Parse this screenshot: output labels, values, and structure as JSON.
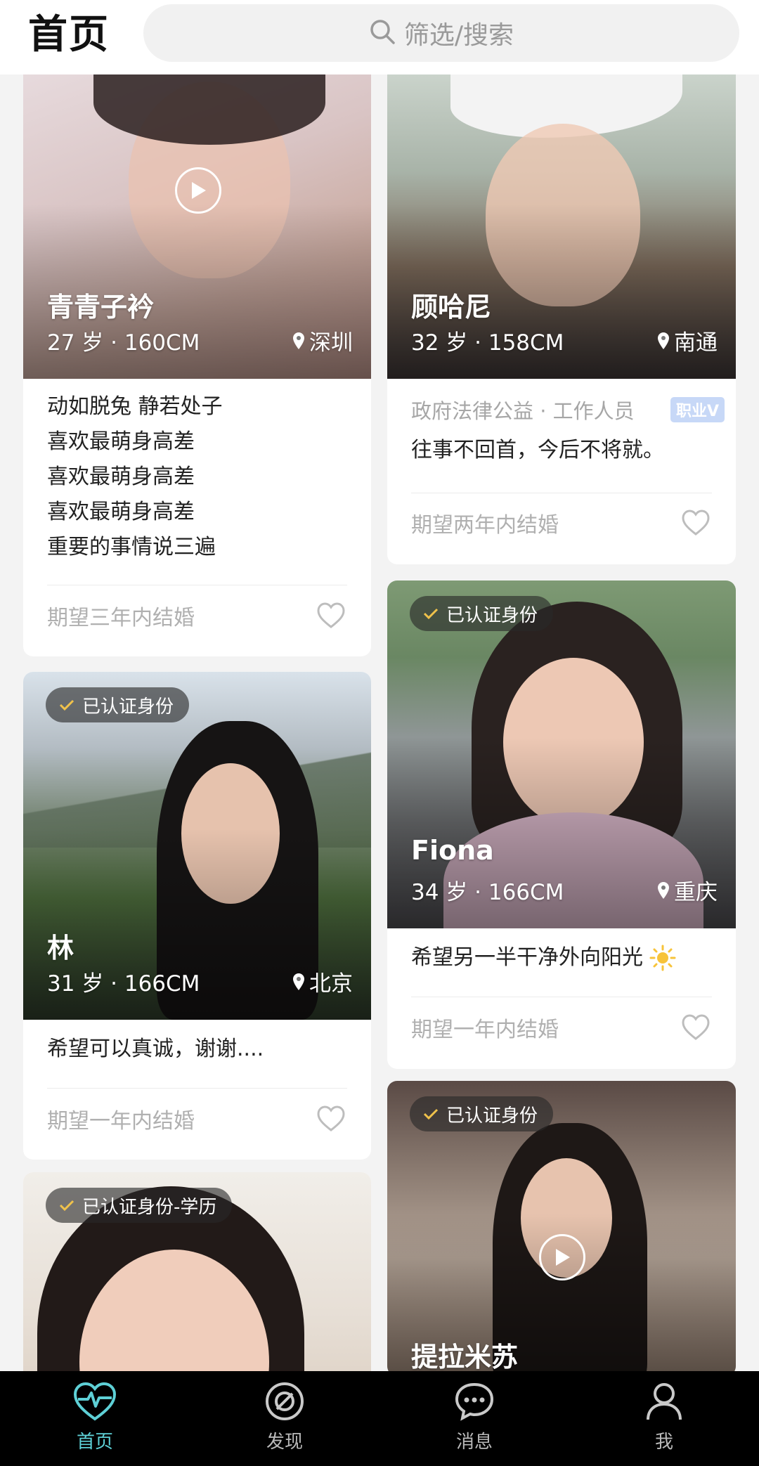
{
  "header": {
    "title": "首页",
    "search_placeholder": "筛选/搜索"
  },
  "cards": [
    {
      "name": "青青子衿",
      "meta": "27 岁 · 160CM",
      "location": "深圳",
      "bio": [
        "动如脱兔 静若处子",
        "喜欢最萌身高差",
        "喜欢最萌身高差",
        "喜欢最萌身高差",
        "重要的事情说三遍"
      ],
      "expect": "期望三年内结婚",
      "has_video": true
    },
    {
      "name": "顾哈尼",
      "meta": "32 岁 · 158CM",
      "location": "南通",
      "job": "政府法律公益 · 工作人员",
      "job_tag": "职业V",
      "bio": [
        "往事不回首，今后不将就。"
      ],
      "expect": "期望两年内结婚"
    },
    {
      "badge": "已认证身份",
      "name": "林",
      "meta": "31 岁 · 166CM",
      "location": "北京",
      "bio": [
        "希望可以真诚，谢谢...."
      ],
      "expect": "期望一年内结婚"
    },
    {
      "badge": "已认证身份",
      "name": "Fiona",
      "meta": "34 岁 · 166CM",
      "location": "重庆",
      "bio": [
        "希望另一半干净外向阳光"
      ],
      "expect": "期望一年内结婚"
    },
    {
      "badge": "已认证身份-学历"
    },
    {
      "badge": "已认证身份",
      "name": "提拉米苏",
      "has_video": true
    }
  ],
  "tabs": [
    {
      "label": "首页",
      "icon": "heart-pulse-icon",
      "active": true
    },
    {
      "label": "发现",
      "icon": "discover-icon"
    },
    {
      "label": "消息",
      "icon": "message-icon"
    },
    {
      "label": "我",
      "icon": "profile-icon"
    }
  ],
  "colors": {
    "accent": "#5ed0d6",
    "tabbar_bg": "#000000",
    "badge_bg": "rgba(40,40,40,0.62)",
    "check": "#f0c24b"
  }
}
